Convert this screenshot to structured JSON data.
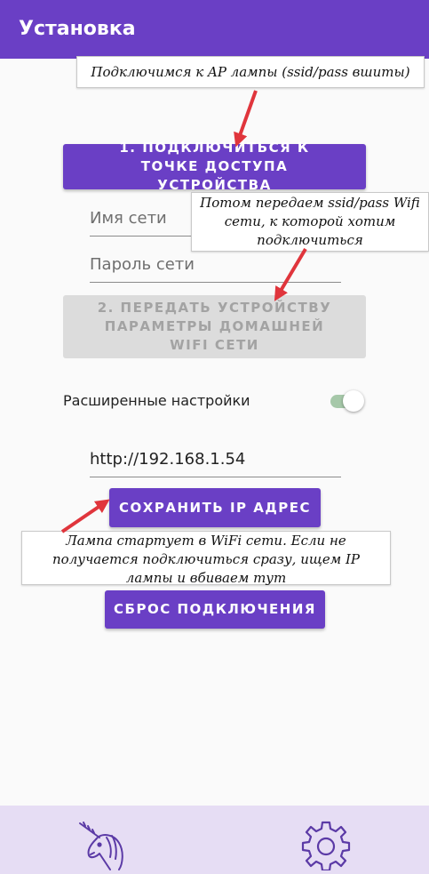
{
  "app": {
    "title": "Установка"
  },
  "notes": {
    "ap": "Подключимся к AP лампы (ssid/pass вшиты)",
    "creds": "Потом передаем ssid/pass Wifi сети, к которой хотим подключиться",
    "ip": "Лампа стартует в WiFi сети. Если не получается подключиться сразу, ищем IP лампы и вбиваем тут"
  },
  "buttons": {
    "connect_ap": "1. ПОДКЛЮЧИТЬСЯ К ТОЧКЕ ДОСТУПА УСТРОЙСТВА",
    "send_params": "2. ПЕРЕДАТЬ УСТРОЙСТВУ ПАРАМЕТРЫ ДОМАШНЕЙ WIFI СЕТИ",
    "save_ip": "СОХРАНИТЬ IP АДРЕС",
    "reset": "СБРОС ПОДКЛЮЧЕНИЯ"
  },
  "fields": {
    "ssid_placeholder": "Имя сети",
    "password_placeholder": "Пароль сети",
    "ip_value": "http://192.168.1.54"
  },
  "settings": {
    "advanced_label": "Расширенные настройки",
    "advanced_enabled": true
  },
  "nav": {
    "left_icon": "unicorn-icon",
    "right_icon": "gear-icon"
  },
  "colors": {
    "accent": "#6a3fc5",
    "annotation_arrow": "#e0353c",
    "bottom_bar": "#e6ddf4"
  }
}
